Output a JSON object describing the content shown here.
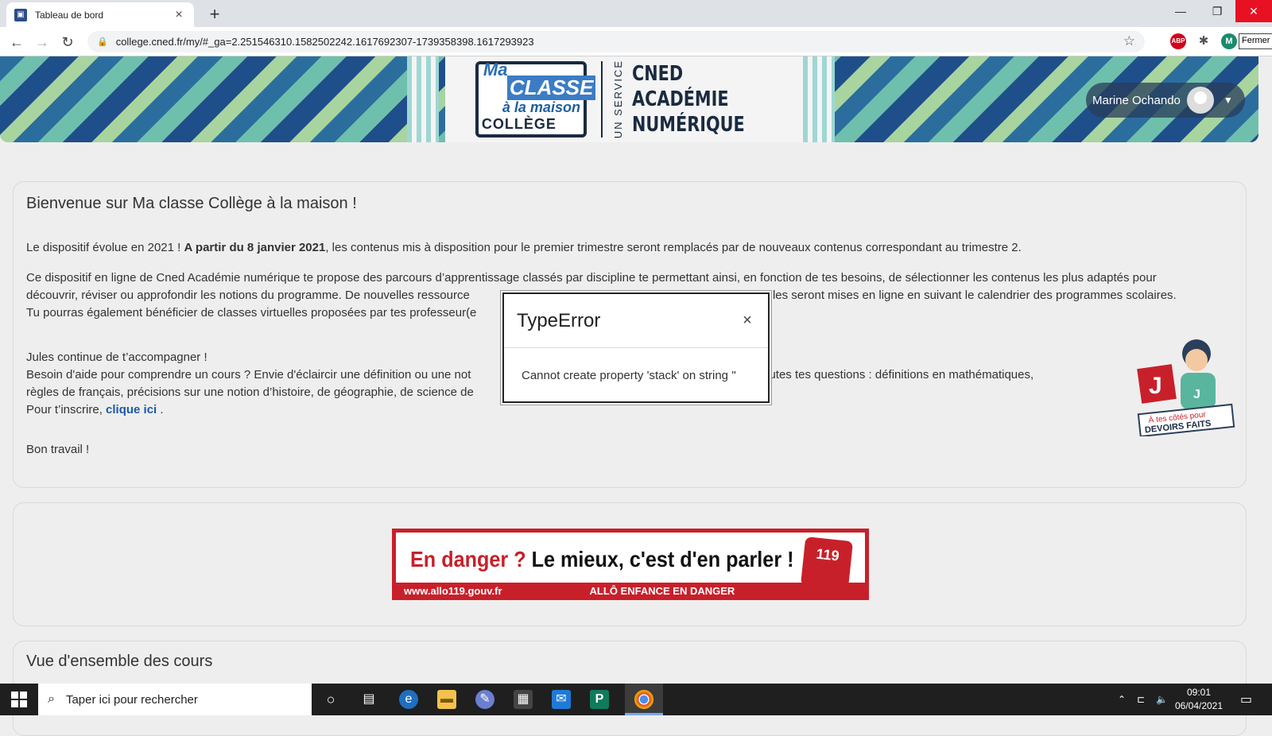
{
  "browser": {
    "tab_title": "Tableau de bord",
    "tab_favicon": "cned-favicon",
    "url": "college.cned.fr/my/#_ga=2.251546310.1582502242.1617692307-1739358398.1617293923",
    "profile_initial": "M",
    "extension_abp": "ABP",
    "fermer_tooltip": "Fermer"
  },
  "header": {
    "logo": {
      "ma": "Ma",
      "classe": "CLASSE",
      "maison": "à la maison",
      "college": "COLLÈGE"
    },
    "un_service": "UN SERVICE",
    "cned_lines": [
      "CNED",
      "ACADÉMIE",
      "NUMÉRIQUE"
    ],
    "user_name": "Marine Ochando"
  },
  "welcome": {
    "title": "Bienvenue sur Ma classe Collège à la maison !",
    "p1_start": "Le dispositif évolue en 2021 ! ",
    "p1_bold": "A partir du 8 janvier 2021",
    "p1_end": ", les contenus mis à disposition pour le premier trimestre seront remplacés par de nouveaux contenus correspondant au trimestre 2.",
    "p2_line1": "Ce dispositif en ligne de Cned Académie numérique te propose des parcours d’apprentissage classés par discipline te permettant ainsi, en fonction de tes besoins, de sélectionner les contenus les plus adaptés pour",
    "p2_line2": "découvrir, réviser ou approfondir les notions du programme. De nouvelles ressource",
    "p2_line2b": "s. Elles seront mises en ligne en suivant le calendrier des programmes scolaires.",
    "p2_line3": "Tu pourras également bénéficier de classes virtuelles proposées par tes professeur(e",
    "p3_line1": "Jules continue de t’accompagner !",
    "p3_line2": "Besoin d'aide pour comprendre un cours ? Envie d'éclaircir une définition ou une not",
    "p3_line2b": "à toutes tes questions : définitions en mathématiques,",
    "p3_line3": "règles de français, précisions sur une notion d’histoire, de géographie, de science de",
    "p3_line4_start": "Pour t’inscrire, ",
    "p3_link": "clique ici",
    "p3_line4_end": " .",
    "p4": "Bon travail !",
    "jules_caption_1": "À tes côtés pour",
    "jules_caption_2": "DEVOIRS FAITS"
  },
  "ad": {
    "danger": "En danger ?",
    "message": " Le mieux, c'est d'en parler !",
    "url": "www.allo119.gouv.fr",
    "tagline": "ALLÔ ENFANCE EN DANGER",
    "badge": "119"
  },
  "courses": {
    "title": "Vue d'ensemble des cours"
  },
  "modal": {
    "title": "TypeError",
    "message": "Cannot create property 'stack' on string ''",
    "close_glyph": "×"
  },
  "taskbar": {
    "search_placeholder": "Taper ici pour rechercher",
    "time": "09:01",
    "date": "06/04/2021"
  },
  "colors": {
    "accent_red": "#c8202a",
    "link_blue": "#1a5aa8",
    "taskbar": "#1f1f1f"
  }
}
